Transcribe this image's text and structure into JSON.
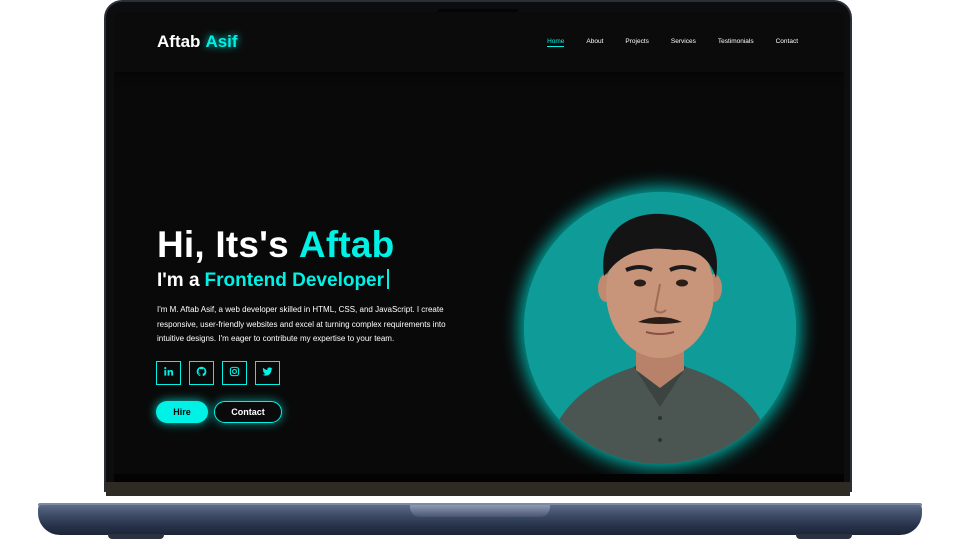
{
  "logo": {
    "first": "Aftab",
    "last": "Asif"
  },
  "nav": {
    "items": [
      {
        "label": "Home",
        "active": true
      },
      {
        "label": "About",
        "active": false
      },
      {
        "label": "Projects",
        "active": false
      },
      {
        "label": "Services",
        "active": false
      },
      {
        "label": "Testimonials",
        "active": false
      },
      {
        "label": "Contact",
        "active": false
      }
    ]
  },
  "hero": {
    "greeting": "Hi, Its's",
    "name": "Aftab",
    "role_prefix": "I'm a",
    "role": "Frontend Developer",
    "description": "I'm M. Aftab Asif, a web developer skilled in HTML, CSS, and JavaScript. I create responsive, user-friendly websites and excel at turning complex requirements into intuitive designs. I'm eager to contribute my expertise to your team."
  },
  "socials": [
    {
      "icon": "linkedin-icon"
    },
    {
      "icon": "github-icon"
    },
    {
      "icon": "instagram-icon"
    },
    {
      "icon": "twitter-icon"
    }
  ],
  "buttons": {
    "hire": "Hire",
    "contact": "Contact"
  },
  "colors": {
    "accent": "#00f2e6",
    "background": "#090909",
    "avatar_bg": "#0f9b98"
  }
}
